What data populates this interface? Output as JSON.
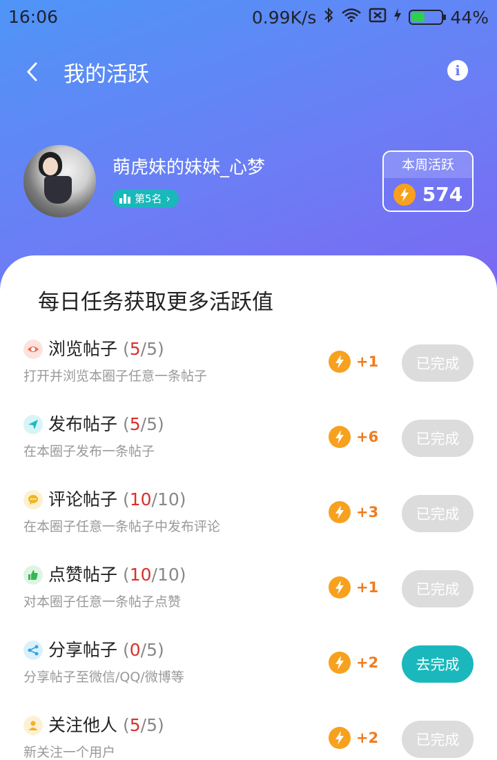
{
  "status_bar": {
    "time": "16:06",
    "speed": "0.99K/s",
    "battery": "44%",
    "battery_level_percent": 44
  },
  "nav": {
    "title": "我的活跃",
    "back_icon": "chevron-left-icon",
    "info_icon": "info-icon"
  },
  "profile": {
    "username": "萌虎妹的妹妹_心梦",
    "rank": "第5名",
    "weekly_label": "本周活跃",
    "weekly_value": "574"
  },
  "tasks_title": "每日任务获取更多活跃值",
  "tasks": [
    {
      "name": "浏览帖子",
      "done": "5",
      "total": "5",
      "desc": "打开并浏览本圈子任意一条帖子",
      "reward": "+1",
      "button": "已完成",
      "icon": "eye-icon",
      "icon_bg": "#fde3dc",
      "icon_color": "#ef6b4f",
      "active": false
    },
    {
      "name": "发布帖子",
      "done": "5",
      "total": "5",
      "desc": "在本圈子发布一条帖子",
      "reward": "+6",
      "button": "已完成",
      "icon": "send-icon",
      "icon_bg": "#d8f4f6",
      "icon_color": "#1fb7c1",
      "active": false
    },
    {
      "name": "评论帖子",
      "done": "10",
      "total": "10",
      "desc": "在本圈子任意一条帖子中发布评论",
      "reward": "+3",
      "button": "已完成",
      "icon": "comment-icon",
      "icon_bg": "#fcf0cf",
      "icon_color": "#f1b521",
      "active": false
    },
    {
      "name": "点赞帖子",
      "done": "10",
      "total": "10",
      "desc": "对本圈子任意一条帖子点赞",
      "reward": "+1",
      "button": "已完成",
      "icon": "thumbs-up-icon",
      "icon_bg": "#def5e3",
      "icon_color": "#34b853",
      "active": false
    },
    {
      "name": "分享帖子",
      "done": "0",
      "total": "5",
      "desc": "分享帖子至微信/QQ/微博等",
      "reward": "+2",
      "button": "去完成",
      "icon": "share-icon",
      "icon_bg": "#dcf0fb",
      "icon_color": "#2ea6e6",
      "active": true
    },
    {
      "name": "关注他人",
      "done": "5",
      "total": "5",
      "desc": "新关注一个用户",
      "reward": "+2",
      "button": "已完成",
      "icon": "user-icon",
      "icon_bg": "#fdf1d3",
      "icon_color": "#f3b02a",
      "active": false
    }
  ]
}
